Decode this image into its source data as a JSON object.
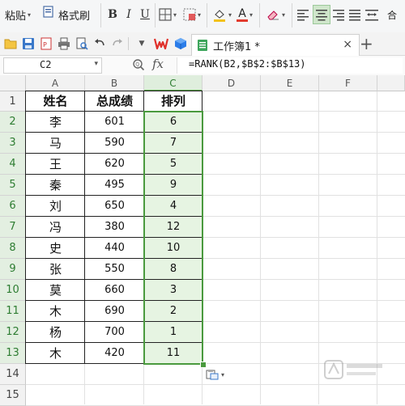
{
  "ribbon": {
    "paste_label": "粘贴",
    "format_painter_label": "格式刷",
    "bold": "B",
    "italic": "I",
    "underline": "U",
    "font_color_letter": "A",
    "highlight_color": "#f2c21b",
    "font_color_bar": "#e23b2e"
  },
  "tabbar": {
    "doc_title": "工作簿1 *",
    "close_glyph": "×",
    "new_tab_glyph": "+"
  },
  "formula_bar": {
    "cell_ref": "C2",
    "fx_label": "fx",
    "formula": "=RANK(B2,$B$2:$B$13)"
  },
  "sheet": {
    "columns": [
      "A",
      "B",
      "C",
      "D",
      "E",
      "F"
    ],
    "rows": [
      "1",
      "2",
      "3",
      "4",
      "5",
      "6",
      "7",
      "8",
      "9",
      "10",
      "11",
      "12",
      "13",
      "14",
      "15"
    ],
    "header": {
      "a": "姓名",
      "b": "总成绩",
      "c": "排列"
    },
    "data": [
      {
        "a": "李",
        "b": "601",
        "c": "6"
      },
      {
        "a": "马",
        "b": "590",
        "c": "7"
      },
      {
        "a": "王",
        "b": "620",
        "c": "5"
      },
      {
        "a": "秦",
        "b": "495",
        "c": "9"
      },
      {
        "a": "刘",
        "b": "650",
        "c": "4"
      },
      {
        "a": "冯",
        "b": "380",
        "c": "12"
      },
      {
        "a": "史",
        "b": "440",
        "c": "10"
      },
      {
        "a": "张",
        "b": "550",
        "c": "8"
      },
      {
        "a": "莫",
        "b": "660",
        "c": "3"
      },
      {
        "a": "木",
        "b": "690",
        "c": "2"
      },
      {
        "a": "杨",
        "b": "700",
        "c": "1"
      },
      {
        "a": "木",
        "b": "420",
        "c": "11"
      }
    ]
  },
  "colors": {
    "selection": "#4a9a3e",
    "selection_fill": "#e6f4e2",
    "wps_red": "#e0302a",
    "cube_blue": "#2b7de9"
  }
}
